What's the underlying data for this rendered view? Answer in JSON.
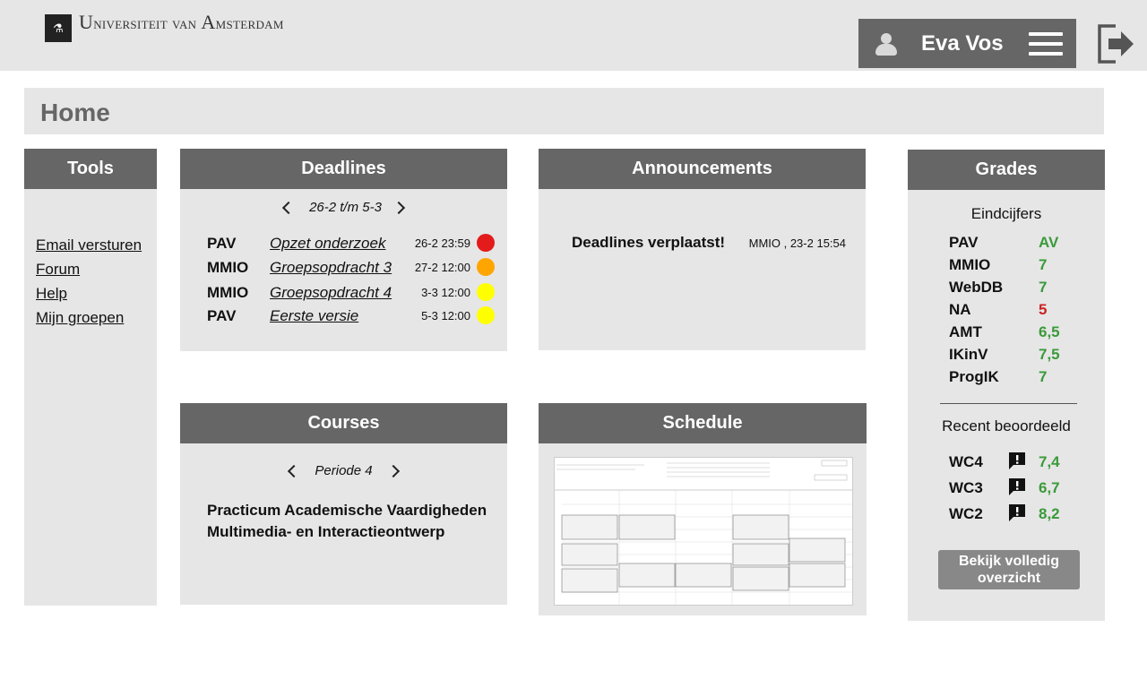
{
  "header": {
    "logo_text": "Universiteit van Amsterdam",
    "user_name": "Eva Vos"
  },
  "page": {
    "title": "Home"
  },
  "tools": {
    "title": "Tools",
    "links": [
      "Email versturen",
      "Forum",
      "Help",
      "Mijn groepen"
    ]
  },
  "deadlines": {
    "title": "Deadlines",
    "range": "26-2 t/m 5-3",
    "items": [
      {
        "course": "PAV",
        "title": "Opzet onderzoek",
        "date": "26-2 23:59",
        "color": "#e31b1b"
      },
      {
        "course": "MMIO",
        "title": "Groepsopdracht 3",
        "date": "27-2 12:00",
        "color": "#ffa500"
      },
      {
        "course": "MMIO",
        "title": "Groepsopdracht 4",
        "date": "3-3 12:00",
        "color": "#ffff00"
      },
      {
        "course": "PAV",
        "title": "Eerste versie",
        "date": "5-3 12:00",
        "color": "#ffff00"
      }
    ]
  },
  "announcements": {
    "title": "Announcements",
    "items": [
      {
        "title": "Deadlines verplaatst!",
        "meta": "MMIO , 23-2 15:54"
      }
    ]
  },
  "courses": {
    "title": "Courses",
    "period": "Periode 4",
    "items": [
      "Practicum Academische Vaardigheden",
      "Multimedia- en Interactieontwerp"
    ]
  },
  "schedule": {
    "title": "Schedule"
  },
  "grades": {
    "title": "Grades",
    "final_label": "Eindcijfers",
    "final": [
      {
        "course": "PAV",
        "grade": "AV",
        "status": "pass"
      },
      {
        "course": "MMIO",
        "grade": "7",
        "status": "pass"
      },
      {
        "course": "WebDB",
        "grade": "7",
        "status": "pass"
      },
      {
        "course": "NA",
        "grade": "5",
        "status": "fail"
      },
      {
        "course": "AMT",
        "grade": "6,5",
        "status": "pass"
      },
      {
        "course": "IKinV",
        "grade": "7,5",
        "status": "pass"
      },
      {
        "course": "ProgIK",
        "grade": "7",
        "status": "pass"
      }
    ],
    "recent_label": "Recent beoordeeld",
    "recent": [
      {
        "name": "WC4",
        "grade": "7,4"
      },
      {
        "name": "WC3",
        "grade": "6,7"
      },
      {
        "name": "WC2",
        "grade": "8,2"
      }
    ],
    "full_button": "Bekijk volledig overzicht"
  },
  "colors": {
    "header_bg": "#666666",
    "panel_bg": "#e6e6e6",
    "pass": "#3a9a3a",
    "fail": "#cc2222"
  }
}
